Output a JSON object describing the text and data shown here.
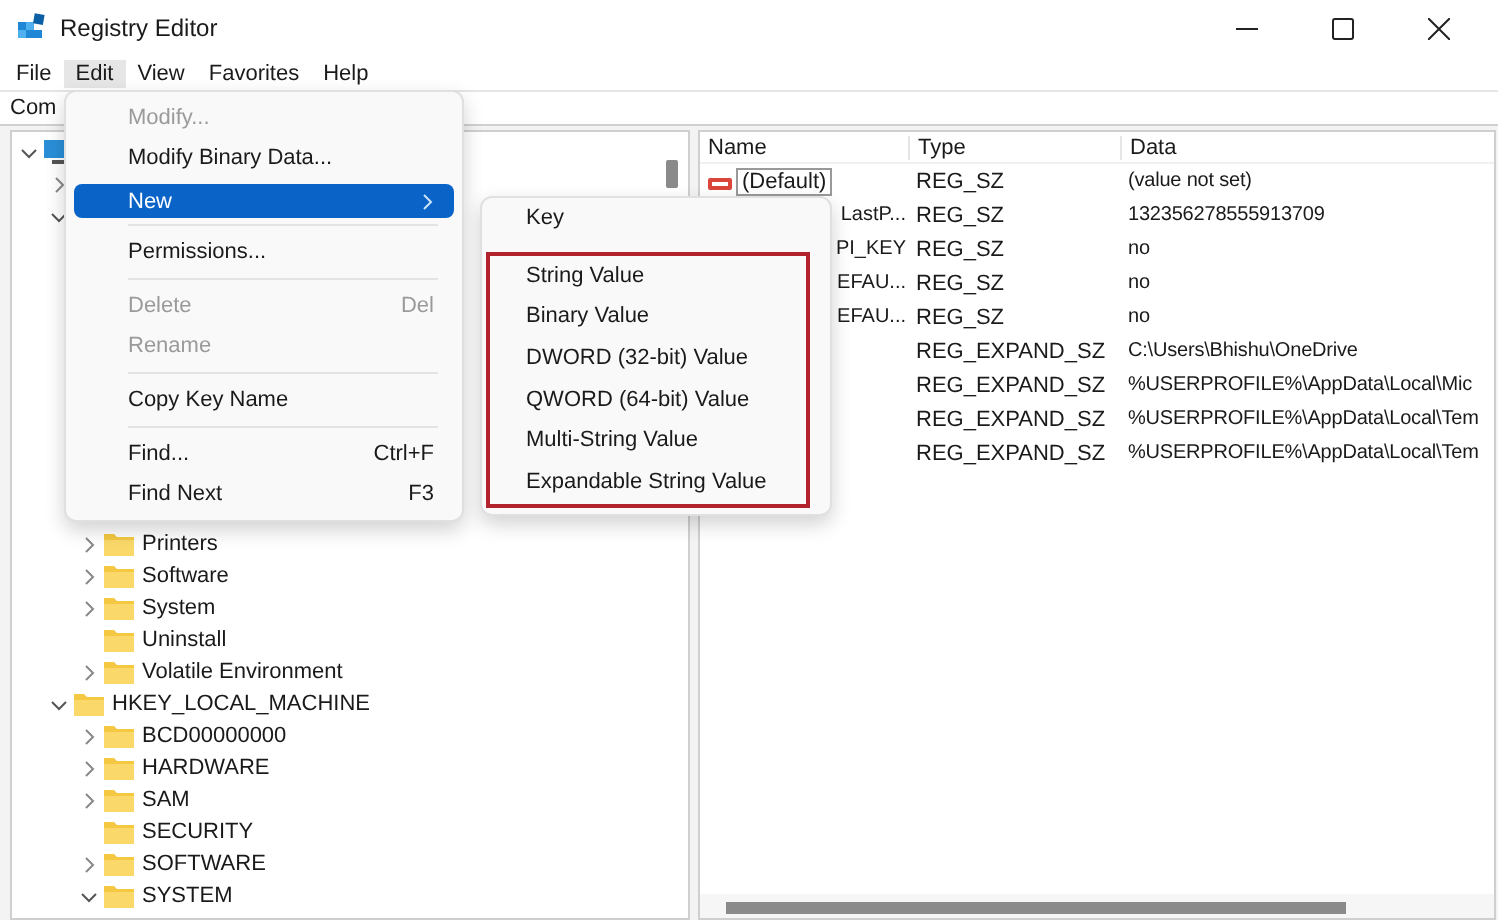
{
  "window": {
    "title": "Registry Editor"
  },
  "menu_bar": [
    {
      "label": "File",
      "selected": false
    },
    {
      "label": "Edit",
      "selected": true
    },
    {
      "label": "View",
      "selected": false
    },
    {
      "label": "Favorites",
      "selected": false
    },
    {
      "label": "Help",
      "selected": false
    }
  ],
  "address_bar": {
    "value": "Com"
  },
  "tree": [
    {
      "kind": "computer",
      "expanded": true,
      "children": [
        {
          "expanded": false
        },
        {
          "expanded": true,
          "children": [
            {
              "label": "Printers",
              "expanded": false
            },
            {
              "label": "Software",
              "expanded": false
            },
            {
              "label": "System",
              "expanded": false
            },
            {
              "label": "Uninstall"
            },
            {
              "label": "Volatile Environment",
              "expanded": false
            }
          ]
        },
        {
          "label": "HKEY_LOCAL_MACHINE",
          "expanded": true,
          "children": [
            {
              "label": "BCD00000000",
              "expanded": false
            },
            {
              "label": "HARDWARE",
              "expanded": false
            },
            {
              "label": "SAM",
              "expanded": false
            },
            {
              "label": "SECURITY"
            },
            {
              "label": "SOFTWARE",
              "expanded": false
            },
            {
              "label": "SYSTEM",
              "expanded": true
            }
          ]
        }
      ]
    }
  ],
  "values_table": {
    "columns": [
      "Name",
      "Type",
      "Data"
    ],
    "rows": [
      {
        "name": "(Default)",
        "icon": true,
        "type": "REG_SZ",
        "data": "(value not set)"
      },
      {
        "name": "LastP...",
        "type": "REG_SZ",
        "data": "132356278555913709"
      },
      {
        "name": "PI_KEY",
        "type": "REG_SZ",
        "data": "no"
      },
      {
        "name": "EFAU...",
        "type": "REG_SZ",
        "data": "no"
      },
      {
        "name": "EFAU...",
        "type": "REG_SZ",
        "data": "no"
      },
      {
        "type": "REG_EXPAND_SZ",
        "data": "C:\\Users\\Bhishu\\OneDrive"
      },
      {
        "type": "REG_EXPAND_SZ",
        "data": "%USERPROFILE%\\AppData\\Local\\Mic"
      },
      {
        "type": "REG_EXPAND_SZ",
        "data": "%USERPROFILE%\\AppData\\Local\\Tem"
      },
      {
        "type": "REG_EXPAND_SZ",
        "data": "%USERPROFILE%\\AppData\\Local\\Tem"
      }
    ]
  },
  "edit_menu": [
    {
      "kind": "item",
      "label": "Modify...",
      "disabled": true,
      "selected": false
    },
    {
      "kind": "item",
      "label": "Modify Binary Data...",
      "disabled": false,
      "selected": false
    },
    {
      "kind": "item",
      "label": "New",
      "disabled": false,
      "selected": true,
      "submenu": true
    },
    {
      "kind": "separator"
    },
    {
      "kind": "item",
      "label": "Permissions...",
      "disabled": false,
      "selected": false
    },
    {
      "kind": "separator"
    },
    {
      "kind": "item",
      "label": "Delete",
      "shortcut": "Del",
      "disabled": true,
      "selected": false
    },
    {
      "kind": "item",
      "label": "Rename",
      "disabled": true,
      "selected": false
    },
    {
      "kind": "separator"
    },
    {
      "kind": "item",
      "label": "Copy Key Name",
      "disabled": false,
      "selected": false
    },
    {
      "kind": "separator"
    },
    {
      "kind": "item",
      "label": "Find...",
      "shortcut": "Ctrl+F",
      "disabled": false,
      "selected": false
    },
    {
      "kind": "item",
      "label": "Find Next",
      "shortcut": "F3",
      "disabled": false,
      "selected": false
    }
  ],
  "new_submenu": [
    {
      "label": "Key",
      "highlighted": false
    },
    {
      "label": "String Value",
      "highlighted": true
    },
    {
      "label": "Binary Value",
      "highlighted": true
    },
    {
      "label": "DWORD (32-bit) Value",
      "highlighted": true
    },
    {
      "label": "QWORD (64-bit) Value",
      "highlighted": true
    },
    {
      "label": "Multi-String Value",
      "highlighted": true
    },
    {
      "label": "Expandable String Value",
      "highlighted": true
    }
  ]
}
